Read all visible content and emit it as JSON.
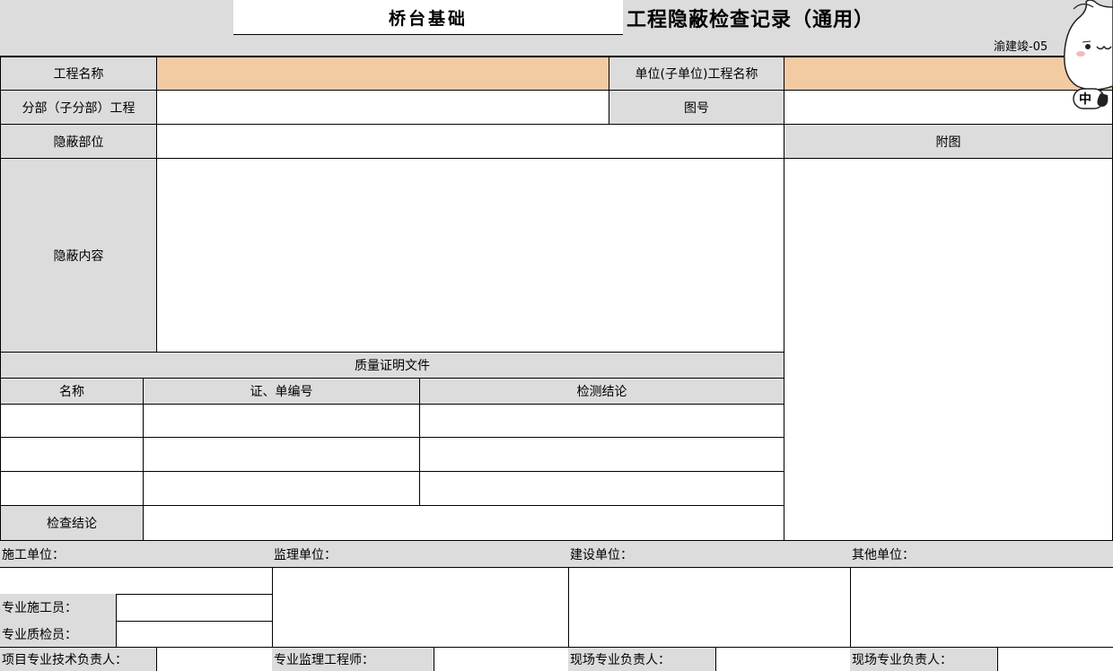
{
  "header": {
    "subtitle": "桥台基础",
    "title": "工程隐蔽检查记录（通用）",
    "form_code": "渝建竣-05"
  },
  "info": {
    "project_name_label": "工程名称",
    "unit_project_label": "单位(子单位)工程名称",
    "sub_project_label": "分部（子分部）工程",
    "drawing_no_label": "图号",
    "hidden_part_label": "隐蔽部位",
    "attachment_label": "附图",
    "hidden_content_label": "隐蔽内容"
  },
  "quality": {
    "section_title": "质量证明文件",
    "columns": [
      "名称",
      "证、单编号",
      "检测结论"
    ]
  },
  "inspection_conclusion_label": "检查结论",
  "units": {
    "construction": "施工单位：",
    "supervision": "监理单位：",
    "owner": "建设单位：",
    "other": "其他单位："
  },
  "signers": {
    "construction_worker": "专业施工员：",
    "quality_inspector": "专业质检员：",
    "tech_lead": "项目专业技术负责人：",
    "supervision_engineer": "专业监理工程师：",
    "owner_rep": "现场专业负责人：",
    "other_rep": "现场专业负责人："
  },
  "mascot": {
    "label": "中"
  },
  "colors": {
    "header_gray": "#dcdcdc",
    "highlight_orange": "#f3cba3"
  }
}
